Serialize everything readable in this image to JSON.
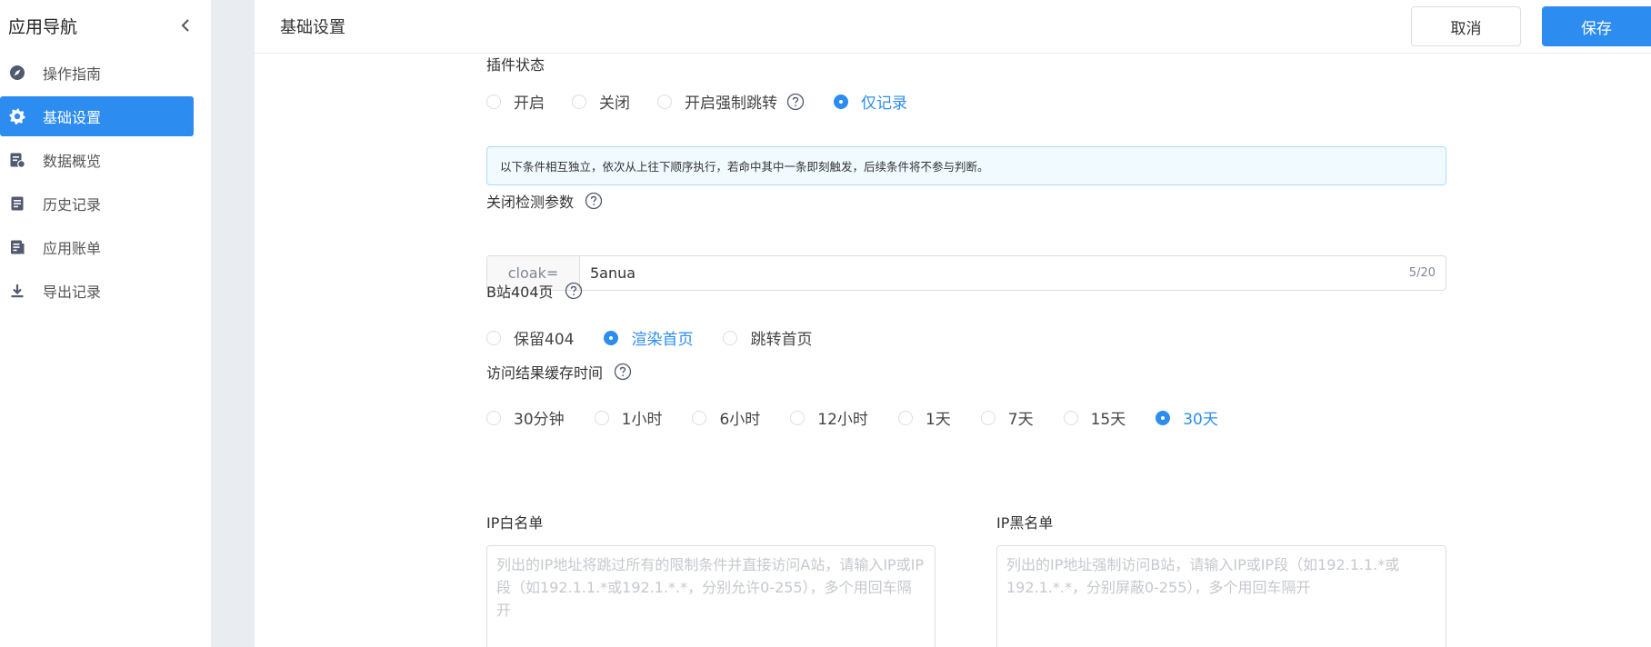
{
  "sidebar": {
    "title": "应用导航",
    "items": [
      {
        "label": "操作指南",
        "icon": "compass-icon"
      },
      {
        "label": "基础设置",
        "icon": "gear-icon",
        "active": true
      },
      {
        "label": "数据概览",
        "icon": "data-report-icon"
      },
      {
        "label": "历史记录",
        "icon": "document-list-icon"
      },
      {
        "label": "应用账单",
        "icon": "bill-icon"
      },
      {
        "label": "导出记录",
        "icon": "download-icon"
      }
    ]
  },
  "header": {
    "title": "基础设置",
    "cancel_label": "取消",
    "save_label": "保存"
  },
  "plugin_status": {
    "label": "插件状态",
    "options": [
      "开启",
      "关闭",
      "开启强制跳转",
      "仅记录"
    ],
    "selected": "仅记录"
  },
  "alert_text": "以下条件相互独立，依次从上往下顺序执行，若命中其中一条即刻触发，后续条件将不参与判断。",
  "close_param": {
    "label": "关闭检测参数",
    "prefix": "cloak=",
    "value": "5anua",
    "count": "5/20"
  },
  "b404": {
    "label": "B站404页",
    "options": [
      "保留404",
      "渲染首页",
      "跳转首页"
    ],
    "selected": "渲染首页"
  },
  "cache_time": {
    "label": "访问结果缓存时间",
    "options": [
      "30分钟",
      "1小时",
      "6小时",
      "12小时",
      "1天",
      "7天",
      "15天",
      "30天"
    ],
    "selected": "30天"
  },
  "ip_whitelist": {
    "label": "IP白名单",
    "placeholder": "列出的IP地址将跳过所有的限制条件并直接访问A站，请输入IP或IP段（如192.1.1.*或192.1.*.*，分别允许0-255），多个用回车隔开"
  },
  "ip_blacklist": {
    "label": "IP黑名单",
    "placeholder": "列出的IP地址强制访问B站，请输入IP或IP段（如192.1.1.*或192.1.*.*，分别屏蔽0-255），多个用回车隔开"
  },
  "colors": {
    "primary": "#2d8cf0",
    "gutter": "#e9ecf1",
    "alert_bg": "#f0faff",
    "alert_border": "#abdcff"
  }
}
